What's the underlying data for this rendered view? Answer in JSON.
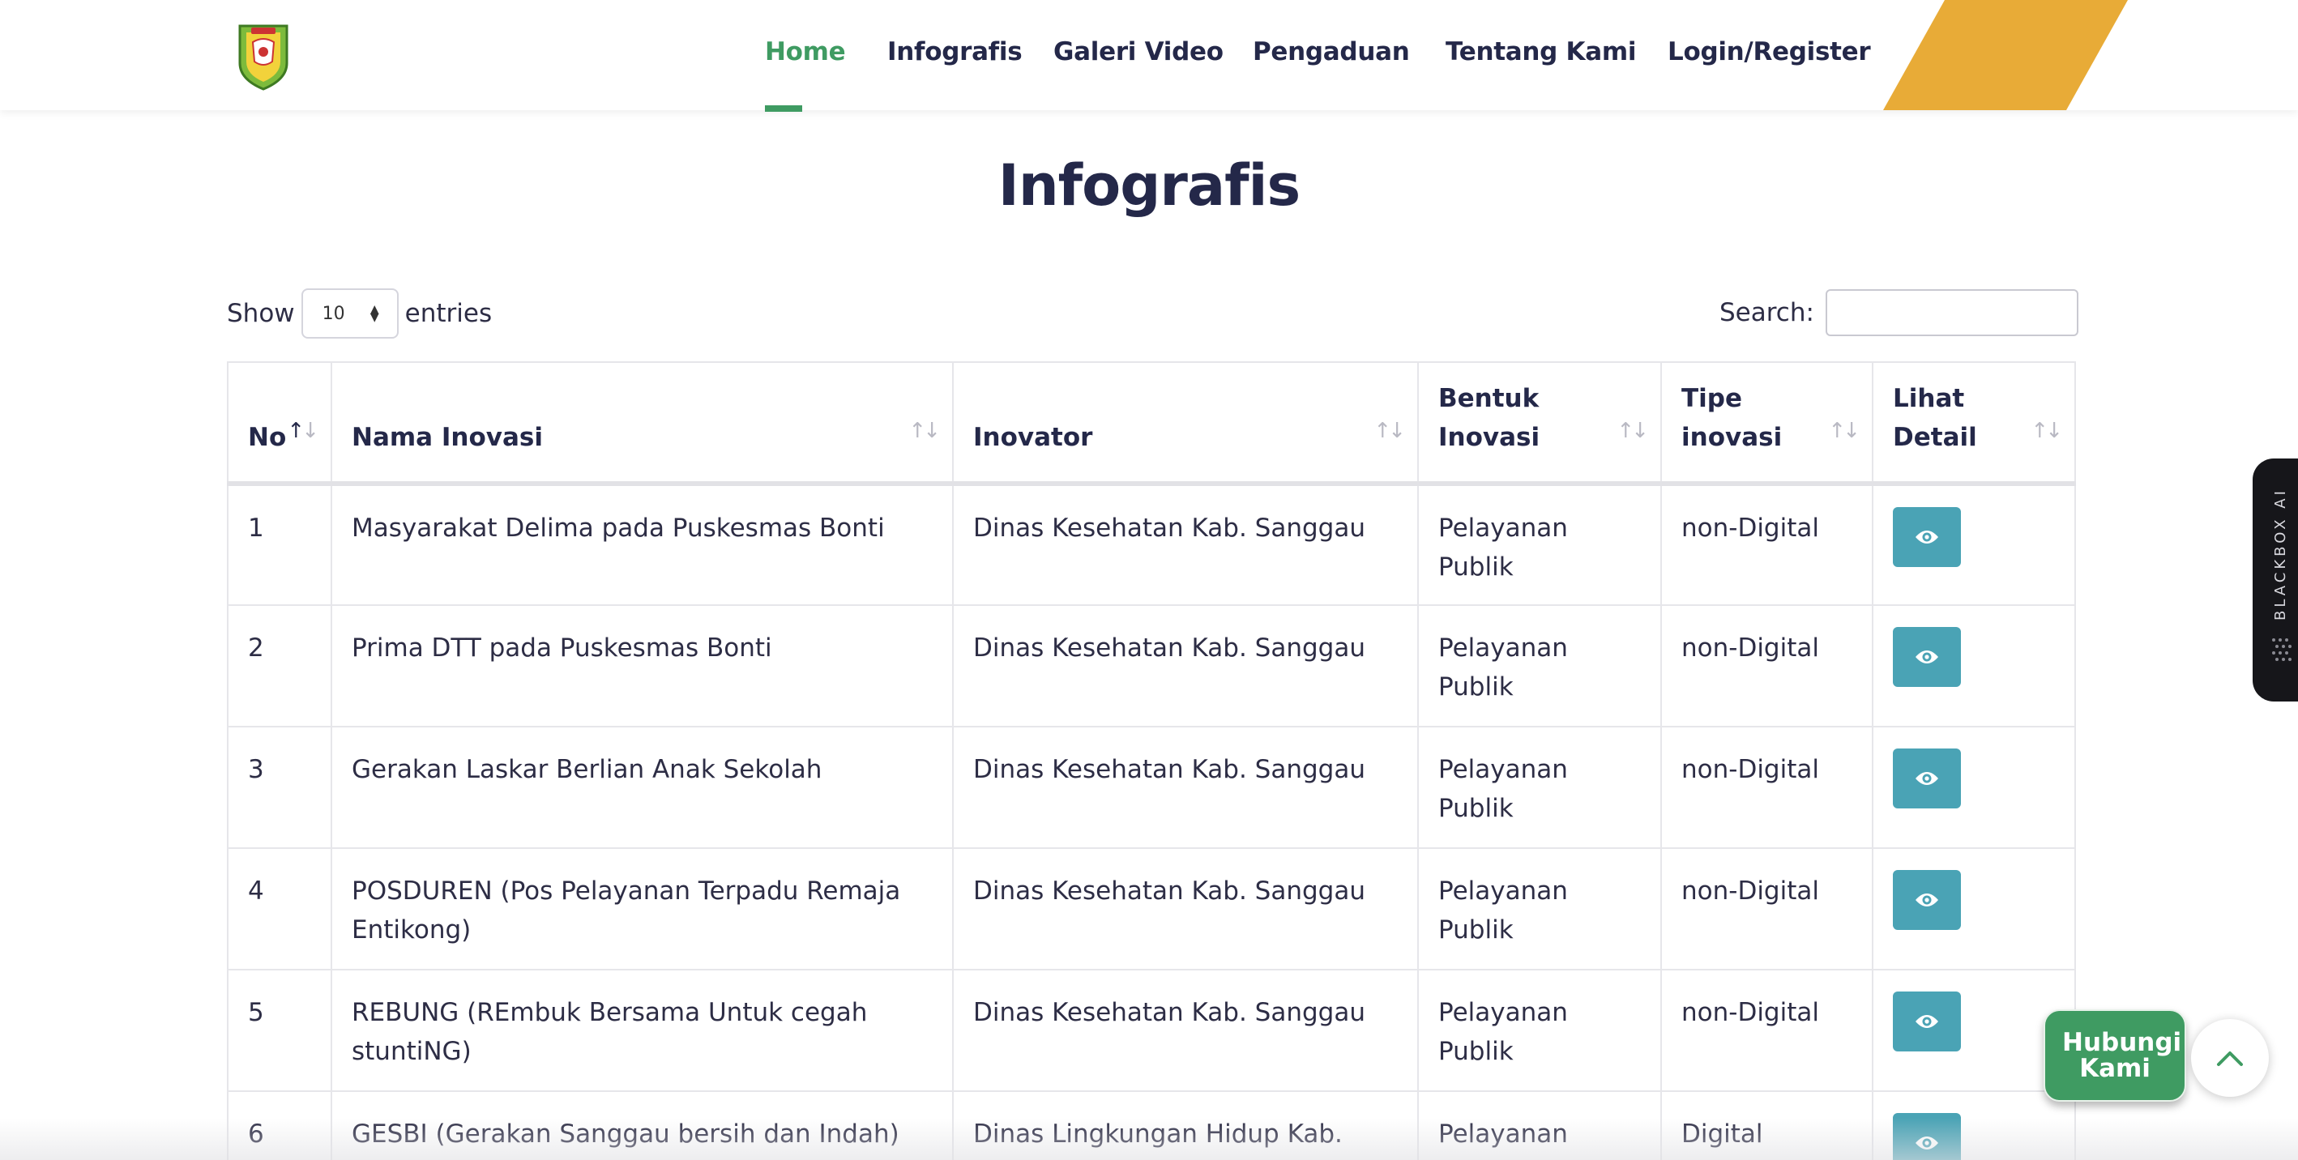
{
  "colors": {
    "brand_green": "#3f9b62",
    "accent_orange": "#e8ab37",
    "navy": "#242849",
    "button_teal": "#4aa3b5"
  },
  "nav": {
    "items": [
      {
        "label": "Home",
        "active": true
      },
      {
        "label": "Infografis",
        "active": false
      },
      {
        "label": "Galeri Video",
        "active": false
      },
      {
        "label": "Pengaduan",
        "active": false
      },
      {
        "label": "Tentang Kami",
        "active": false
      },
      {
        "label": "Login/Register",
        "active": false
      }
    ]
  },
  "page": {
    "title": "Infografis"
  },
  "controls": {
    "show_label": "Show",
    "entries_value": "10",
    "entries_label": "entries",
    "search_label": "Search:",
    "search_value": ""
  },
  "table": {
    "headers": [
      "No",
      "Nama Inovasi",
      "Inovator",
      "Bentuk Inovasi",
      "Tipe inovasi",
      "Lihat Detail"
    ],
    "sort": {
      "column": "No",
      "direction": "ascending"
    },
    "rows": [
      {
        "no": "1",
        "nama": "Masyarakat Delima pada Puskesmas Bonti",
        "inovator": "Dinas Kesehatan Kab. Sanggau",
        "bentuk": "Pelayanan Publik",
        "tipe": "non-Digital"
      },
      {
        "no": "2",
        "nama": "Prima DTT pada Puskesmas Bonti",
        "inovator": "Dinas Kesehatan Kab. Sanggau",
        "bentuk": "Pelayanan Publik",
        "tipe": "non-Digital"
      },
      {
        "no": "3",
        "nama": "Gerakan Laskar Berlian Anak Sekolah",
        "inovator": "Dinas Kesehatan Kab. Sanggau",
        "bentuk": "Pelayanan Publik",
        "tipe": "non-Digital"
      },
      {
        "no": "4",
        "nama": "POSDUREN (Pos Pelayanan Terpadu Remaja Entikong)",
        "inovator": "Dinas Kesehatan Kab. Sanggau",
        "bentuk": "Pelayanan Publik",
        "tipe": "non-Digital"
      },
      {
        "no": "5",
        "nama": "REBUNG (REmbuk Bersama Untuk cegah stuntiNG)",
        "inovator": "Dinas Kesehatan Kab. Sanggau",
        "bentuk": "Pelayanan Publik",
        "tipe": "non-Digital"
      },
      {
        "no": "6",
        "nama": "GESBI (Gerakan Sanggau bersih dan Indah)",
        "inovator": "Dinas Lingkungan Hidup Kab.",
        "bentuk": "Pelayanan",
        "tipe": "Digital"
      }
    ],
    "detail_icon": "eye-icon"
  },
  "side_widget": {
    "label": "BLACKBOX AI"
  },
  "contact": {
    "label": "Hubungi Kami"
  },
  "scroll_top_icon": "chevron-up-icon"
}
